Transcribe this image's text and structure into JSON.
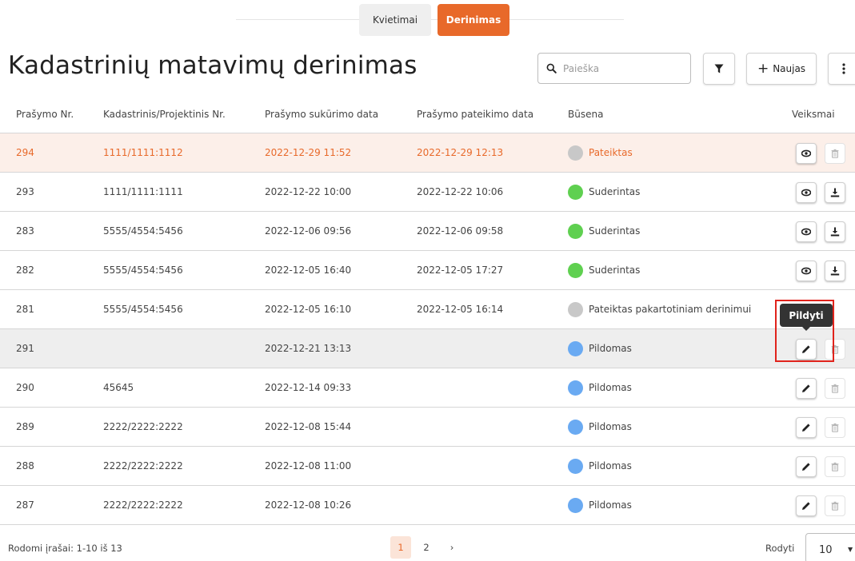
{
  "tabs": [
    {
      "label": "Kvietimai",
      "active": false
    },
    {
      "label": "Derinimas",
      "active": true
    }
  ],
  "header": {
    "title": "Kadastrinių matavimų derinimas",
    "search_placeholder": "Paieška",
    "new_label": "Naujas"
  },
  "icons": {
    "search": "search-icon",
    "filter": "filter-icon",
    "add": "plus-icon",
    "more": "more-vertical-icon",
    "view": "eye-icon",
    "delete": "trash-icon",
    "download": "download-icon",
    "edit": "pencil-icon"
  },
  "table": {
    "headers": [
      "Prašymo Nr.",
      "Kadastrinis/Projektinis Nr.",
      "Prašymo sukūrimo data",
      "Prašymo pateikimo data",
      "Būsena",
      "Veiksmai"
    ],
    "rows": [
      {
        "nr": "294",
        "kad": "1111/1111:1112",
        "created": "2022-12-29 11:52",
        "submitted": "2022-12-29 12:13",
        "status": "Pateiktas",
        "status_color": "#c8c8c8",
        "actions": [
          "view",
          "delete"
        ]
      },
      {
        "nr": "293",
        "kad": "1111/1111:1111",
        "created": "2022-12-22 10:00",
        "submitted": "2022-12-22 10:06",
        "status": "Suderintas",
        "status_color": "#5fd050",
        "actions": [
          "view",
          "download"
        ]
      },
      {
        "nr": "283",
        "kad": "5555/4554:5456",
        "created": "2022-12-06 09:56",
        "submitted": "2022-12-06 09:58",
        "status": "Suderintas",
        "status_color": "#5fd050",
        "actions": [
          "view",
          "download"
        ]
      },
      {
        "nr": "282",
        "kad": "5555/4554:5456",
        "created": "2022-12-05 16:40",
        "submitted": "2022-12-05 17:27",
        "status": "Suderintas",
        "status_color": "#5fd050",
        "actions": [
          "view",
          "download"
        ]
      },
      {
        "nr": "281",
        "kad": "5555/4554:5456",
        "created": "2022-12-05 16:10",
        "submitted": "2022-12-05 16:14",
        "status": "Pateiktas pakartotiniam derinimui",
        "status_color": "#c8c8c8",
        "actions": []
      },
      {
        "nr": "291",
        "kad": "",
        "created": "2022-12-21 13:13",
        "submitted": "",
        "status": "Pildomas",
        "status_color": "#6aaaf2",
        "actions": [
          "edit",
          "delete"
        ]
      },
      {
        "nr": "290",
        "kad": "45645",
        "created": "2022-12-14 09:33",
        "submitted": "",
        "status": "Pildomas",
        "status_color": "#6aaaf2",
        "actions": [
          "edit",
          "delete"
        ]
      },
      {
        "nr": "289",
        "kad": "2222/2222:2222",
        "created": "2022-12-08 15:44",
        "submitted": "",
        "status": "Pildomas",
        "status_color": "#6aaaf2",
        "actions": [
          "edit",
          "delete"
        ]
      },
      {
        "nr": "288",
        "kad": "2222/2222:2222",
        "created": "2022-12-08 11:00",
        "submitted": "",
        "status": "Pildomas",
        "status_color": "#6aaaf2",
        "actions": [
          "edit",
          "delete"
        ]
      },
      {
        "nr": "287",
        "kad": "2222/2222:2222",
        "created": "2022-12-08 10:26",
        "submitted": "",
        "status": "Pildomas",
        "status_color": "#6aaaf2",
        "actions": [
          "edit",
          "delete"
        ]
      }
    ]
  },
  "tooltip": {
    "text": "Pildyti"
  },
  "footer": {
    "records_text": "Rodomi įrašai: 1-10 iš 13",
    "pages": [
      "1",
      "2"
    ],
    "current_page": "1",
    "next_symbol": "›",
    "page_size_label": "Rodyti",
    "page_size_value": "10"
  },
  "colors": {
    "accent": "#e8692a",
    "highlight_row": "#fcefe9",
    "hover_row": "#eeeeee",
    "focus_outline": "#e0231c"
  }
}
